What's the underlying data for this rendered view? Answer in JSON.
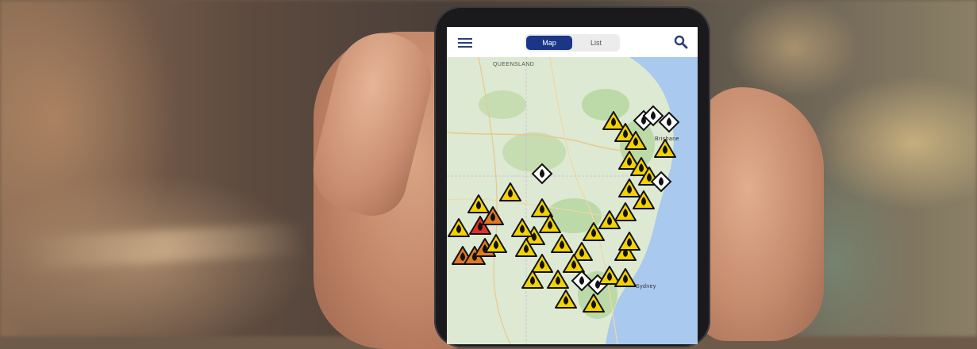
{
  "app": {
    "menu_icon": "hamburger-icon",
    "tabs": [
      {
        "label": "Map",
        "selected": true
      },
      {
        "label": "List",
        "selected": false
      }
    ],
    "search_icon": "search-icon"
  },
  "map": {
    "labels": {
      "region": "QUEENSLAND",
      "city_1": "Brisbane",
      "city_2": "Sydney"
    },
    "marker_types": {
      "advice": {
        "color": "#f2d200",
        "icon": "fire-warning-icon"
      },
      "watch_and_act": {
        "color": "#e07a1f",
        "icon": "fire-warning-icon"
      },
      "emergency": {
        "color": "#e0302a",
        "icon": "fire-warning-icon"
      },
      "not_applicable": {
        "color": "#ffffff",
        "icon": "fire-info-icon"
      }
    },
    "colors": {
      "land": "#d9e8cf",
      "ocean": "#a9c9ee",
      "parks": "#b9d9a4"
    }
  }
}
